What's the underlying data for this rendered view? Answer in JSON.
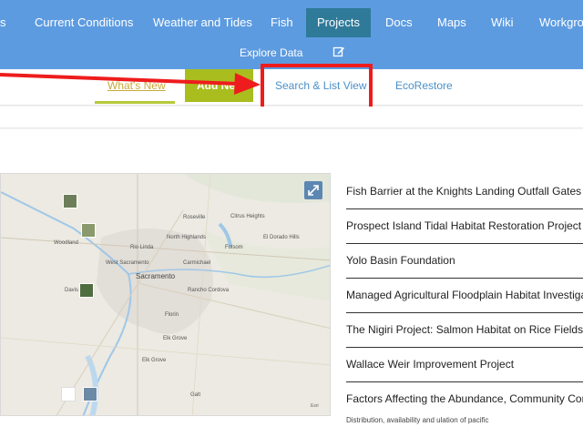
{
  "nav": {
    "items": [
      "s",
      "Current Conditions",
      "Weather and Tides",
      "Fish",
      "Projects",
      "Docs",
      "Maps",
      "Wiki",
      "Workgrou"
    ],
    "active": "Projects",
    "explore_label": "Explore Data"
  },
  "subnav": {
    "whats_new": "What's New",
    "add_new": "Add Ne",
    "search_list": "Search & List View",
    "ecorestore": "EcoRestore"
  },
  "map": {
    "labels": [
      "Woodland",
      "Davis",
      "Sacramento",
      "Elk Grove",
      "Roseville",
      "Citrus Heights",
      "Folsom",
      "El Dorado Hills",
      "Carmichael",
      "Rancho Cordova",
      "West Sacramento",
      "Florin",
      "Elk Grove",
      "Galt",
      "Rio Linda",
      "North Highlands"
    ],
    "credit": "Esri"
  },
  "projects": [
    "Fish Barrier at the Knights Landing Outfall Gates",
    "Prospect Island Tidal Habitat Restoration Project",
    "Yolo Basin Foundation",
    "Managed Agricultural Floodplain Habitat Investiga",
    "The Nigiri Project: Salmon Habitat on Rice Fields",
    "Wallace Weir Improvement Project",
    "Factors Affecting the Abundance, Community Com"
  ],
  "projects_sub": "Distribution, availability and ulation of pacific",
  "colors": {
    "nav_bg": "#5d9be0",
    "nav_active": "#2f7a99",
    "add_button": "#a9bd1f",
    "highlight": "#ee1c1c"
  }
}
